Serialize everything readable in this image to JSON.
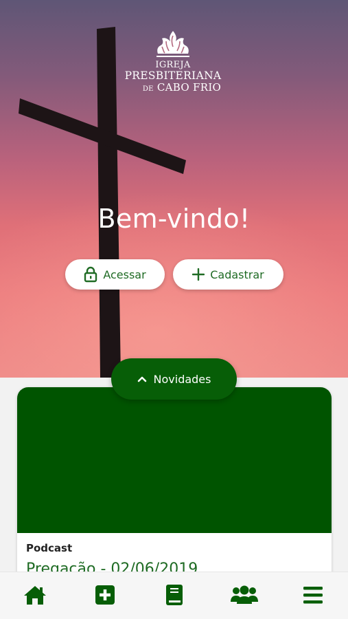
{
  "hero": {
    "logo": {
      "line1": "IGREJA",
      "line2": "PRESBITERIANA",
      "line3_prefix": "DE",
      "line3": "CABO FRIO"
    },
    "welcome": "Bem-vindo!",
    "login_button": "Acessar",
    "register_button": "Cadastrar"
  },
  "news_tab": {
    "label": "Novidades",
    "icon": "chevron-up-icon"
  },
  "news_card": {
    "category": "Podcast",
    "title": "Pregação - 02/06/2019",
    "image_color": "#005400"
  },
  "bottom_nav": {
    "items": [
      {
        "icon": "home-icon"
      },
      {
        "icon": "plus-square-icon"
      },
      {
        "icon": "book-icon"
      },
      {
        "icon": "users-icon"
      },
      {
        "icon": "menu-icon"
      }
    ]
  },
  "colors": {
    "brand_green": "#075e07",
    "text_green": "#1f6b24",
    "cross": "#1d1416"
  }
}
